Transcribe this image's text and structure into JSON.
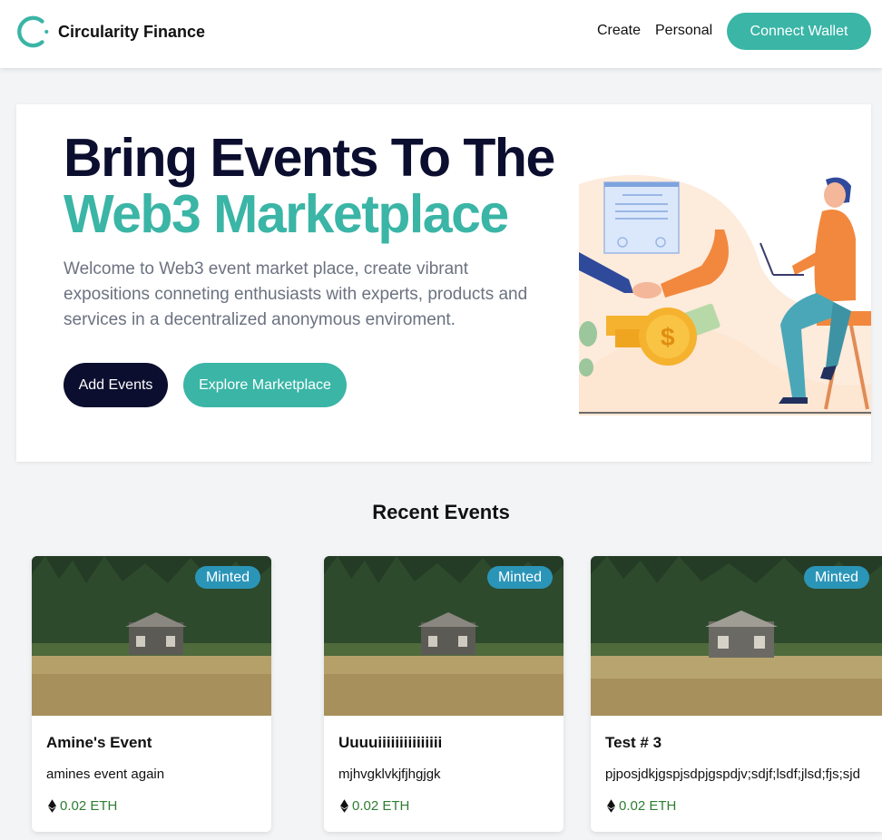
{
  "navbar": {
    "brand": "Circularity Finance",
    "links": [
      "Create",
      "Personal"
    ],
    "connect_label": "Connect Wallet"
  },
  "hero": {
    "title_line1": "Bring Events To The",
    "title_line2": "Web3 Marketplace",
    "description": "Welcome to Web3 event market place, create vibrant expositions conneting enthusiasts with experts, products and services in a decentralized anonymous enviroment.",
    "add_label": "Add Events",
    "explore_label": "Explore Marketplace"
  },
  "recent": {
    "title": "Recent Events",
    "events": [
      {
        "badge": "Minted",
        "title": "Amine's Event",
        "description": "amines event again",
        "price": "0.02 ETH"
      },
      {
        "badge": "Minted",
        "title": "Uuuuiiiiiiiiiiiiiii",
        "description": "mjhvgklvkjfjhgjgk",
        "price": "0.02 ETH"
      },
      {
        "badge": "Minted",
        "title": "Test # 3",
        "description": "pjposjdkjgspjsdpjgspdjv;sdjf;lsdf;jlsd;fjs;sjd",
        "price": "0.02 ETH"
      }
    ]
  },
  "colors": {
    "accent": "#3ab5a6",
    "dark": "#0b0e2e",
    "badge": "#2b95b8",
    "price": "#2e7d32"
  },
  "icons": [
    "circularity-logo-icon",
    "eth-icon"
  ]
}
